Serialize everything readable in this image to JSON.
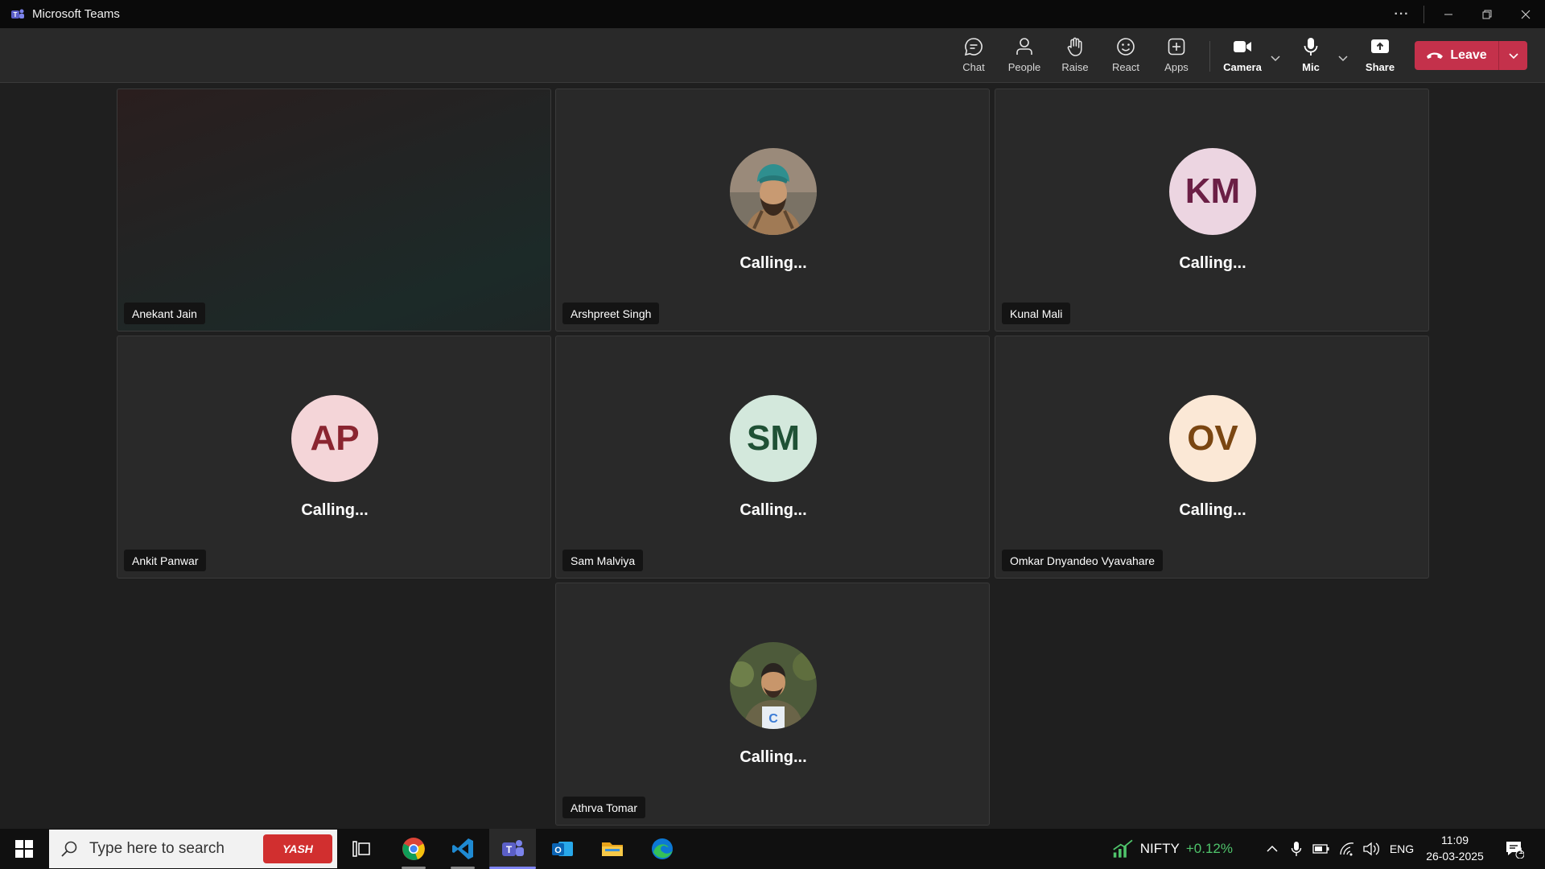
{
  "window": {
    "title": "Microsoft Teams",
    "more": "···"
  },
  "toolbar": {
    "chat": "Chat",
    "people": "People",
    "raise": "Raise",
    "react": "React",
    "apps": "Apps",
    "camera": "Camera",
    "mic": "Mic",
    "share": "Share",
    "leave": "Leave"
  },
  "participants": [
    {
      "name": "Anekant Jain",
      "status": ""
    },
    {
      "name": "Arshpreet Singh",
      "status": "Calling..."
    },
    {
      "name": "Kunal Mali",
      "status": "Calling...",
      "initials": "KM",
      "avatar_bg": "#ecd5e1",
      "avatar_fg": "#6b1f45"
    },
    {
      "name": "Ankit Panwar",
      "status": "Calling...",
      "initials": "AP",
      "avatar_bg": "#f4d5d8",
      "avatar_fg": "#8a2530"
    },
    {
      "name": "Sam Malviya",
      "status": "Calling...",
      "initials": "SM",
      "avatar_bg": "#d3e8dc",
      "avatar_fg": "#1f5135"
    },
    {
      "name": "Omkar Dnyandeo Vyavahare",
      "status": "Calling...",
      "initials": "OV",
      "avatar_bg": "#fbe8d6",
      "avatar_fg": "#7a4612"
    },
    {
      "name": "Athrva Tomar",
      "status": "Calling..."
    }
  ],
  "taskbar": {
    "search_placeholder": "Type here to search",
    "search_badge": "YASH",
    "ticker_name": "NIFTY",
    "ticker_change": "+0.12%",
    "language": "ENG",
    "time": "11:09",
    "date": "26-03-2025",
    "notification_count": "1"
  },
  "colors": {
    "leave": "#c4314b",
    "ticker_up": "#4fc46b",
    "teams_accent": "#7f85f5"
  }
}
